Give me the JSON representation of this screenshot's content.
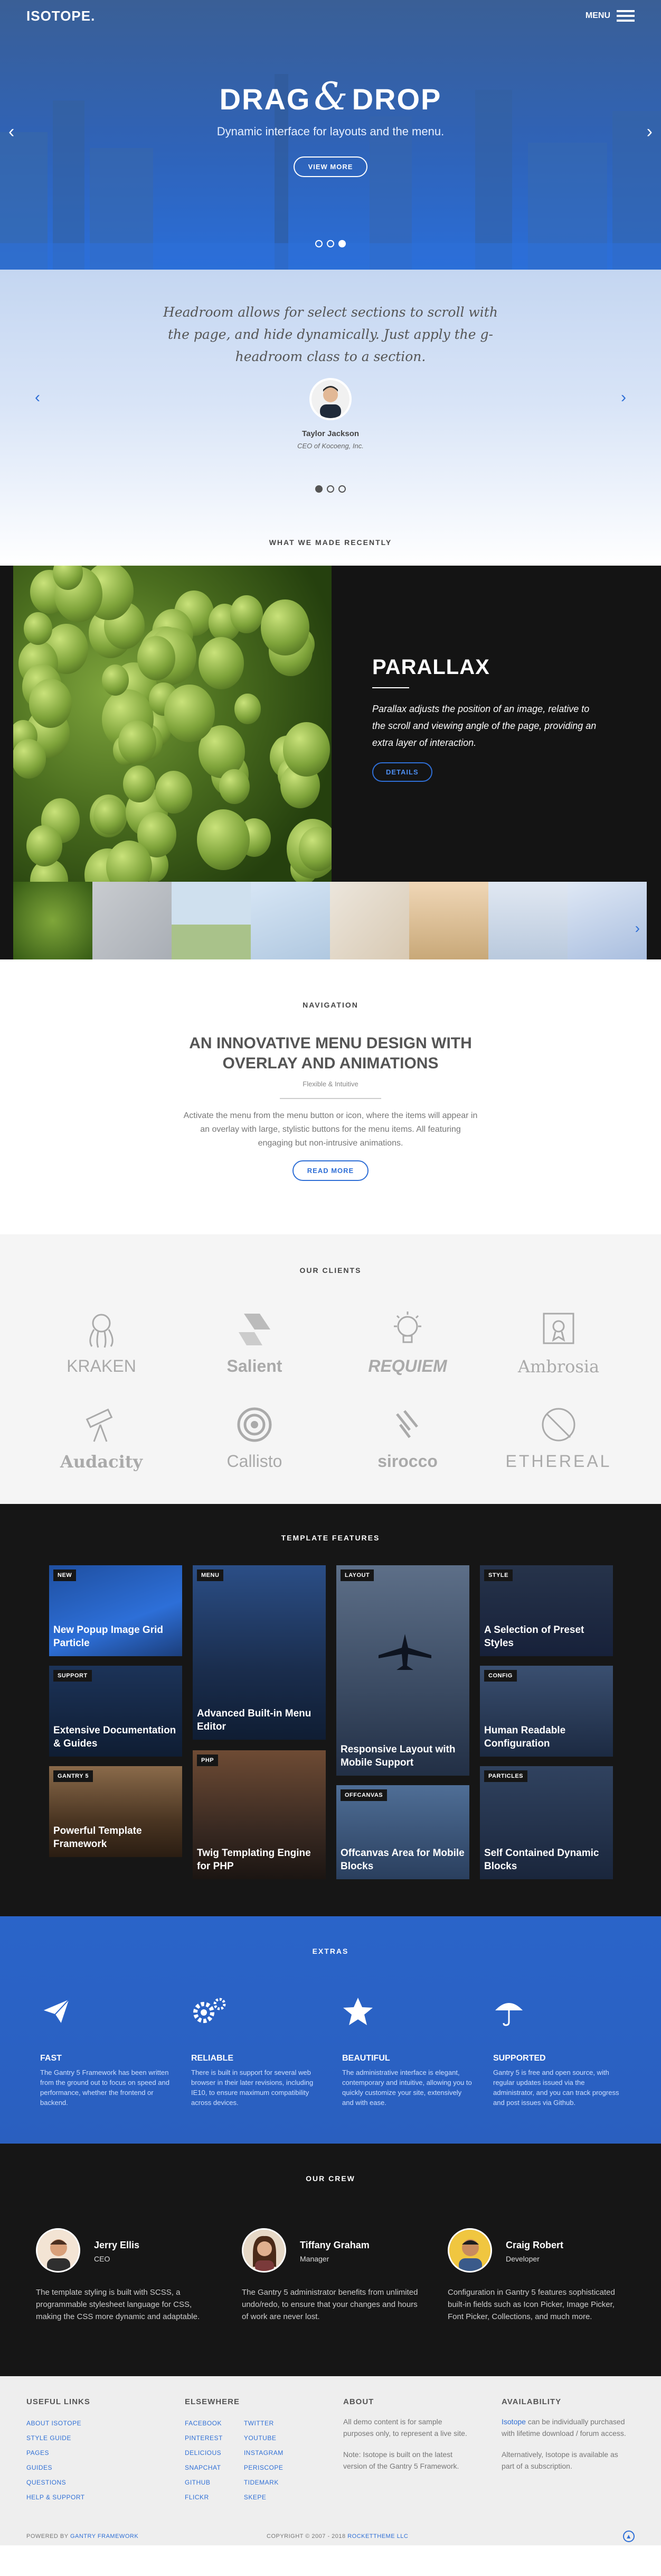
{
  "header": {
    "logo": "ISOTOPE.",
    "menu_label": "MENU"
  },
  "hero": {
    "title_left": "DRAG",
    "title_amp": "&",
    "title_right": "DROP",
    "subtitle": "Dynamic interface for layouts and the menu.",
    "cta": "VIEW MORE",
    "slide_count": 3,
    "active_slide": 3
  },
  "testimonial": {
    "quote": "Headroom allows for select sections to scroll with the page, and hide dynamically. Just apply the g-headroom class to a section.",
    "name": "Taylor Jackson",
    "role": "CEO of Kocoeng, Inc.",
    "active_slide": 1
  },
  "recent": {
    "title": "WHAT WE MADE RECENTLY"
  },
  "parallax": {
    "title": "PARALLAX",
    "text": "Parallax adjusts the position of an image, relative to the scroll and viewing angle of the page, providing an extra layer of interaction.",
    "button": "DETAILS"
  },
  "navigation": {
    "label": "NAVIGATION",
    "heading": "AN INNOVATIVE MENU DESIGN WITH OVERLAY AND ANIMATIONS",
    "small": "Flexible & Intuitive",
    "text": "Activate the menu from the menu button or icon, where the items will appear in an overlay with large, stylistic buttons for the menu items. All featuring engaging but non-intrusive animations.",
    "button": "READ MORE"
  },
  "clients": {
    "title": "OUR CLIENTS",
    "items": [
      "KRAKEN",
      "Salient",
      "REQUIEM",
      "Ambrosia",
      "Audacity",
      "Callisto",
      "sirocco",
      "ETHEREAL"
    ]
  },
  "features": {
    "title": "TEMPLATE FEATURES",
    "tiles": [
      {
        "tag": "NEW",
        "title": "New Popup Image Grid Particle"
      },
      {
        "tag": "MENU",
        "title": "Advanced Built-in Menu Editor"
      },
      {
        "tag": "LAYOUT",
        "title": "Responsive Layout with Mobile Support"
      },
      {
        "tag": "STYLE",
        "title": "A Selection of Preset Styles"
      },
      {
        "tag": "SUPPORT",
        "title": "Extensive Documentation & Guides"
      },
      {
        "tag": "CONFIG",
        "title": "Human Readable Configuration"
      },
      {
        "tag": "GANTRY 5",
        "title": "Powerful Template Framework"
      },
      {
        "tag": "PHP",
        "title": "Twig Templating Engine for PHP"
      },
      {
        "tag": "OFFCANVAS",
        "title": "Offcanvas Area for Mobile Blocks"
      },
      {
        "tag": "PARTICLES",
        "title": "Self Contained Dynamic Blocks"
      }
    ]
  },
  "extras": {
    "title": "EXTRAS",
    "items": [
      {
        "icon": "paper-plane-icon",
        "title": "FAST",
        "text": "The Gantry 5 Framework has been written from the ground out to focus on speed and performance, whether the frontend or backend."
      },
      {
        "icon": "cogs-icon",
        "title": "RELIABLE",
        "text": "There is built in support for several web browser in their later revisions, including IE10, to ensure maximum compatibility across devices."
      },
      {
        "icon": "star-icon",
        "title": "BEAUTIFUL",
        "text": "The administrative interface is elegant, contemporary and intuitive, allowing you to quickly customize your site, extensively and with ease."
      },
      {
        "icon": "umbrella-icon",
        "title": "SUPPORTED",
        "text": "Gantry 5 is free and open source, with regular updates issued via the administrator, and you can track progress and post issues via Github."
      }
    ]
  },
  "crew": {
    "title": "OUR CREW",
    "members": [
      {
        "name": "Jerry Ellis",
        "role": "CEO",
        "bio": "The template styling is built with SCSS, a programmable stylesheet language for CSS, making the CSS more dynamic and adaptable."
      },
      {
        "name": "Tiffany Graham",
        "role": "Manager",
        "bio": "The Gantry 5 administrator benefits from unlimited undo/redo, to ensure that your changes and hours of work are never lost."
      },
      {
        "name": "Craig Robert",
        "role": "Developer",
        "bio": "Configuration in Gantry 5 features sophisticated built-in fields such as Icon Picker, Image Picker, Font Picker, Collections, and much more."
      }
    ]
  },
  "footer": {
    "useful": {
      "title": "USEFUL LINKS",
      "links": [
        "ABOUT ISOTOPE",
        "STYLE GUIDE",
        "PAGES",
        "GUIDES",
        "QUESTIONS",
        "HELP & SUPPORT"
      ]
    },
    "elsewhere": {
      "title": "ELSEWHERE",
      "links_a": [
        "FACEBOOK",
        "PINTEREST",
        "DELICIOUS",
        "SNAPCHAT",
        "GITHUB",
        "FLICKR"
      ],
      "links_b": [
        "TWITTER",
        "YOUTUBE",
        "INSTAGRAM",
        "PERISCOPE",
        "TIDEMARK",
        "SKEPE"
      ]
    },
    "about": {
      "title": "ABOUT",
      "p1": "All demo content is for sample purposes only, to represent a live site.",
      "p2": "Note: Isotope is built on the latest version of the Gantry 5 Framework."
    },
    "availability": {
      "title": "AVAILABILITY",
      "link": "Isotope",
      "p1_rest": " can be individually purchased with lifetime download / forum access.",
      "p2": "Alternatively, Isotope is available as part of a subscription."
    },
    "powered_prefix": "POWERED BY ",
    "powered_link": "GANTRY FRAMEWORK",
    "copyright": "COPYRIGHT © 2007 - 2018 ",
    "copyright_link": "ROCKETTHEME LLC"
  }
}
